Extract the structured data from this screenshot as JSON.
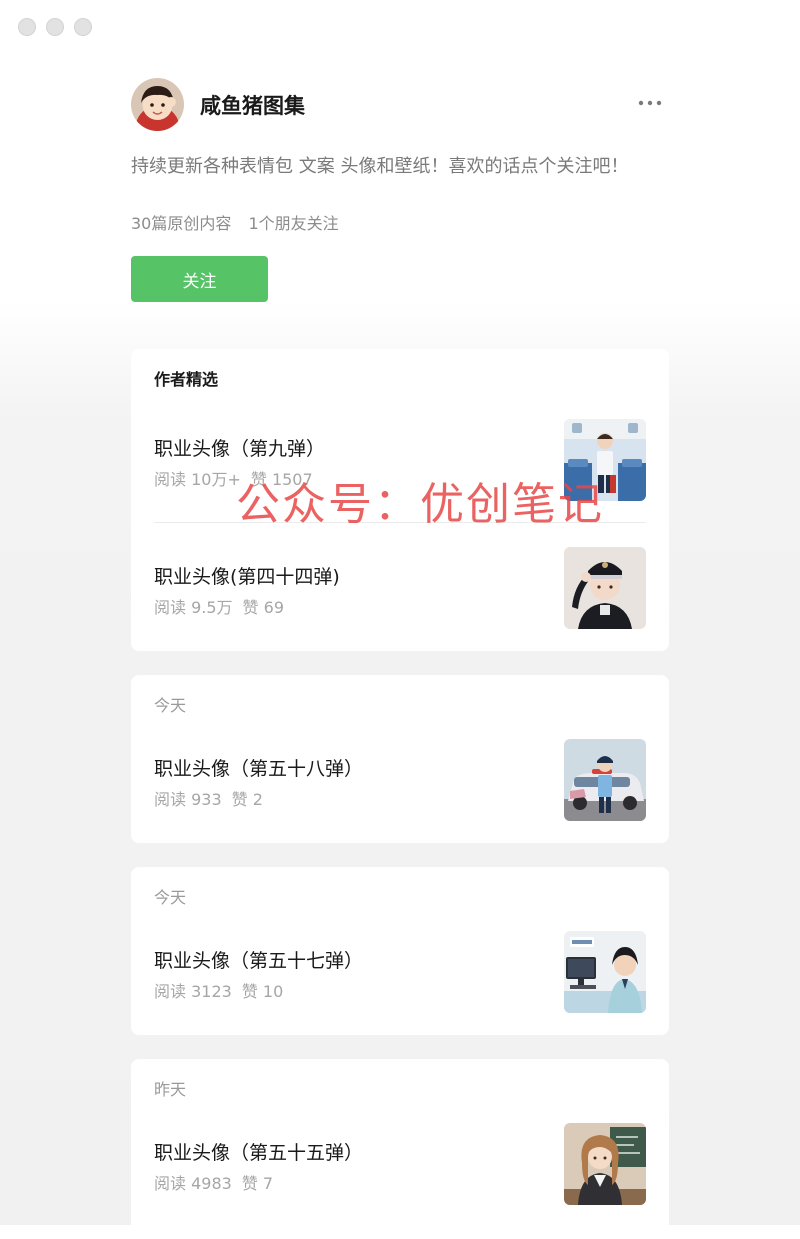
{
  "window": {
    "controls": [
      "close",
      "minimize",
      "maximize"
    ]
  },
  "profile": {
    "name": "咸鱼猪图集",
    "bio": "持续更新各种表情包 文案 头像和壁纸！喜欢的话点个关注吧！",
    "stats": {
      "articles": "30篇原创内容",
      "friends": "1个朋友关注"
    },
    "follow_label": "关注",
    "more_icon": "more-dots-icon"
  },
  "featured": {
    "header": "作者精选",
    "articles": [
      {
        "title": "职业头像（第九弹）",
        "reads": "阅读 10万+",
        "likes": "赞 1507",
        "thumb": "boy-in-airplane-cabin"
      },
      {
        "title": "职业头像(第四十四弹)",
        "reads": "阅读 9.5万",
        "likes": "赞 69",
        "thumb": "girl-police-officer-saluting"
      }
    ]
  },
  "feed": [
    {
      "date": "今天",
      "title": "职业头像（第五十八弹）",
      "reads": "阅读 933",
      "likes": "赞 2",
      "thumb": "boy-with-police-car"
    },
    {
      "date": "今天",
      "title": "职业头像（第五十七弹）",
      "reads": "阅读 3123",
      "likes": "赞 10",
      "thumb": "girl-at-office-desk"
    },
    {
      "date": "昨天",
      "title": "职业头像（第五十五弹）",
      "reads": "阅读 4983",
      "likes": "赞 7",
      "thumb": "teacher-at-chalkboard"
    }
  ],
  "watermark": "公众号：优创笔记",
  "colors": {
    "accent": "#55c366",
    "watermark": "#e84646",
    "muted_text": "#a6a6a6"
  }
}
